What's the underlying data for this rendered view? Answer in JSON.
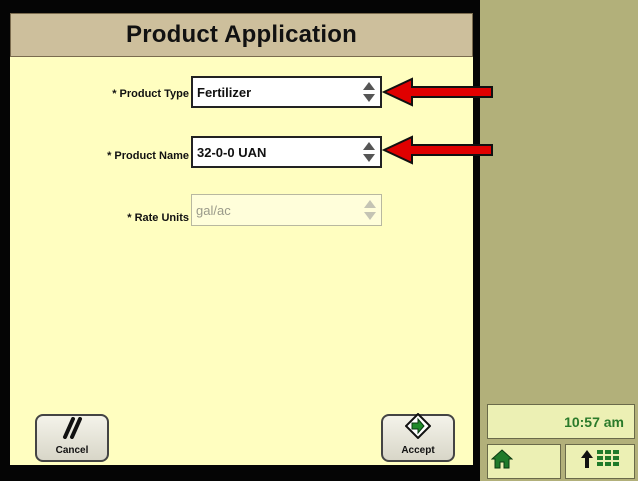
{
  "dialog": {
    "title": "Product Application",
    "fields": [
      {
        "label": "* Product Type",
        "value": "Fertilizer",
        "enabled": true
      },
      {
        "label": "* Product Name",
        "value": "32-0-0 UAN",
        "enabled": true
      },
      {
        "label": "* Rate Units",
        "value": "gal/ac",
        "enabled": false
      }
    ],
    "cancel_label": "Cancel",
    "accept_label": "Accept"
  },
  "status": {
    "clock": "10:57 am"
  },
  "icons": {
    "cancel": "cancel-slash-icon",
    "accept": "accept-arrow-icon",
    "home": "home-icon",
    "menu": "menu-grid-icon",
    "spin": "spin-updown-icon",
    "annotation": "red-arrow-icon"
  },
  "colors": {
    "content_bg": "#fffec0",
    "title_bg": "#cdbf9c",
    "side_bg": "#b2b07a",
    "clock_text": "#2a7a2a",
    "annotation_arrow": "#e00000"
  }
}
